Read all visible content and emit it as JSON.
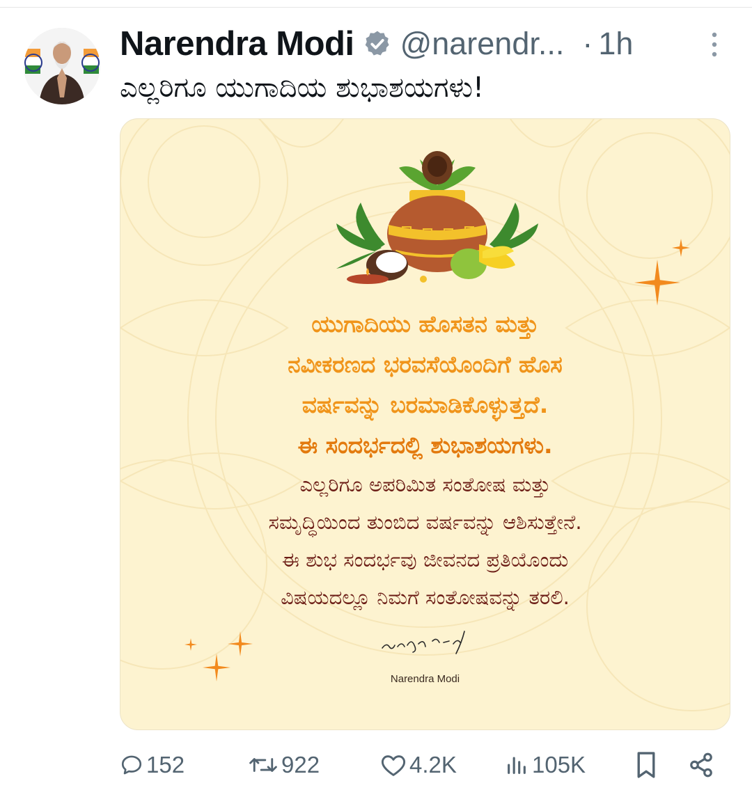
{
  "author": {
    "name": "Narendra Modi",
    "handle": "@narendr...",
    "separator": "·",
    "time": "1h"
  },
  "tweet": {
    "text": "ಎಲ್ಲರಿಗೂ ಯುಗಾದಿಯ ಶುಭಾಶಯಗಳು!"
  },
  "card": {
    "greeting_lines": [
      "ಯುಗಾದಿಯು ಹೊಸತನ ಮತ್ತು",
      "ನವೀಕರಣದ ಭರವಸೆಯೊಂದಿಗೆ ಹೊಸ",
      "ವರ್ಷವನ್ನು ಬರಮಾಡಿಕೊಳ್ಳುತ್ತದೆ.",
      "ಈ ಸಂದರ್ಭದಲ್ಲಿ ಶುಭಾಶಯಗಳು."
    ],
    "wish_lines": [
      "ಎಲ್ಲರಿಗೂ ಅಪರಿಮಿತ ಸಂತೋಷ ಮತ್ತು",
      "ಸಮೃದ್ಧಿಯಿಂದ ತುಂಬಿದ ವರ್ಷವನ್ನು ಆಶಿಸುತ್ತೇನೆ.",
      "ಈ ಶುಭ ಸಂದರ್ಭವು ಜೀವನದ ಪ್ರತಿಯೊಂದು",
      "ವಿಷಯದಲ್ಲೂ ನಿಮಗೆ ಸಂತೋಷವನ್ನು ತರಲಿ."
    ],
    "signature_name": "Narendra Modi"
  },
  "actions": {
    "replies": "152",
    "reposts": "922",
    "likes": "4.2K",
    "views": "105K"
  },
  "colors": {
    "card_bg": "#fdf3d0",
    "greeting_orange": "#f0941a",
    "wish_maroon": "#6b1c15",
    "verified_blue": "#8b98a5",
    "icon_grey": "#536471"
  }
}
